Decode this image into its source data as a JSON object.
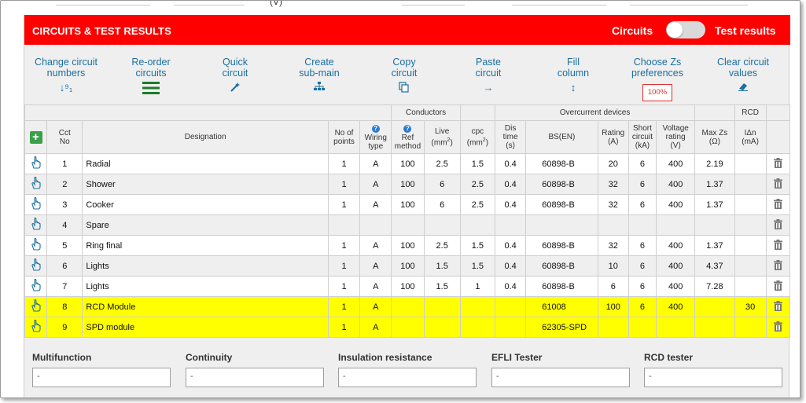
{
  "top_strip": {
    "unit_label": "(V)"
  },
  "header": {
    "title": "CIRCUITS & TEST RESULTS",
    "toggle_left_label": "Circuits",
    "toggle_right_label": "Test results",
    "colors": {
      "accent": "#ff0000",
      "link": "#1a6fa0",
      "highlight": "#ffff00"
    }
  },
  "toolbar": [
    {
      "label": "Change circuit numbers",
      "icon": "sort-numeric-icon",
      "glyph": "↓⁹₁"
    },
    {
      "label": "Re-order circuits",
      "icon": "hamburger-icon",
      "glyph": ""
    },
    {
      "label": "Quick circuit",
      "icon": "magic-wand-icon",
      "glyph": ""
    },
    {
      "label": "Create sub-main",
      "icon": "sitemap-icon",
      "glyph": ""
    },
    {
      "label": "Copy circuit",
      "icon": "copy-icon",
      "glyph": ""
    },
    {
      "label": "Paste circuit",
      "icon": "arrow-right-icon",
      "glyph": "→"
    },
    {
      "label": "Fill column",
      "icon": "arrows-vertical-icon",
      "glyph": "↕"
    },
    {
      "label": "Choose Zs preferences",
      "icon": "badge",
      "badge": "100%"
    },
    {
      "label": "Clear circuit values",
      "icon": "eraser-icon",
      "glyph": ""
    }
  ],
  "table": {
    "group_headers": {
      "conductors": "Conductors",
      "overcurrent": "Overcurrent devices",
      "rcd": "RCD"
    },
    "columns": {
      "cct_no": [
        "Cct",
        "No"
      ],
      "designation": "Designation",
      "no_of_points": [
        "No of",
        "points"
      ],
      "wiring_type": [
        "Wiring",
        "type"
      ],
      "ref_method": [
        "Ref",
        "method"
      ],
      "live": [
        "Live",
        "(mm",
        ")"
      ],
      "cpc": [
        "cpc",
        "(mm",
        ")"
      ],
      "dis_time": [
        "Dis",
        "time",
        "(s)"
      ],
      "bs_en": "BS(EN)",
      "rating": [
        "Rating",
        "(A)"
      ],
      "short_circuit": [
        "Short",
        "circuit",
        "(kA)"
      ],
      "voltage_rating": [
        "Voltage",
        "rating",
        "(V)"
      ],
      "max_zs": [
        "Max Zs",
        "(Ω)"
      ],
      "idn": [
        "IΔn",
        "(mA)"
      ]
    },
    "rows": [
      {
        "no": "1",
        "designation": "Radial",
        "points": "1",
        "wiring": "A",
        "ref": "100",
        "live": "2.5",
        "cpc": "1.5",
        "dis": "0.4",
        "bsen": "60898-B",
        "rating": "20",
        "sc": "6",
        "volt": "400",
        "zs": "2.19",
        "idn": "",
        "highlight": false
      },
      {
        "no": "2",
        "designation": "Shower",
        "points": "1",
        "wiring": "A",
        "ref": "100",
        "live": "6",
        "cpc": "2.5",
        "dis": "0.4",
        "bsen": "60898-B",
        "rating": "32",
        "sc": "6",
        "volt": "400",
        "zs": "1.37",
        "idn": "",
        "highlight": false
      },
      {
        "no": "3",
        "designation": "Cooker",
        "points": "1",
        "wiring": "A",
        "ref": "100",
        "live": "6",
        "cpc": "2.5",
        "dis": "0.4",
        "bsen": "60898-B",
        "rating": "32",
        "sc": "6",
        "volt": "400",
        "zs": "1.37",
        "idn": "",
        "highlight": false
      },
      {
        "no": "4",
        "designation": "Spare",
        "points": "",
        "wiring": "",
        "ref": "",
        "live": "",
        "cpc": "",
        "dis": "",
        "bsen": "",
        "rating": "",
        "sc": "",
        "volt": "",
        "zs": "",
        "idn": "",
        "highlight": false
      },
      {
        "no": "5",
        "designation": "Ring final",
        "points": "1",
        "wiring": "A",
        "ref": "100",
        "live": "2.5",
        "cpc": "1.5",
        "dis": "0.4",
        "bsen": "60898-B",
        "rating": "32",
        "sc": "6",
        "volt": "400",
        "zs": "1.37",
        "idn": "",
        "highlight": false
      },
      {
        "no": "6",
        "designation": "Lights",
        "points": "1",
        "wiring": "A",
        "ref": "100",
        "live": "1.5",
        "cpc": "1.5",
        "dis": "0.4",
        "bsen": "60898-B",
        "rating": "10",
        "sc": "6",
        "volt": "400",
        "zs": "4.37",
        "idn": "",
        "highlight": false
      },
      {
        "no": "7",
        "designation": "Lights",
        "points": "1",
        "wiring": "A",
        "ref": "100",
        "live": "1.5",
        "cpc": "1",
        "dis": "0.4",
        "bsen": "60898-B",
        "rating": "6",
        "sc": "6",
        "volt": "400",
        "zs": "7.28",
        "idn": "",
        "highlight": false
      },
      {
        "no": "8",
        "designation": "RCD Module",
        "points": "1",
        "wiring": "A",
        "ref": "",
        "live": "",
        "cpc": "",
        "dis": "",
        "bsen": "61008",
        "rating": "100",
        "sc": "6",
        "volt": "400",
        "zs": "",
        "idn": "30",
        "highlight": true
      },
      {
        "no": "9",
        "designation": "SPD module",
        "points": "1",
        "wiring": "A",
        "ref": "",
        "live": "",
        "cpc": "",
        "dis": "",
        "bsen": "62305-SPD",
        "rating": "",
        "sc": "",
        "volt": "",
        "zs": "",
        "idn": "",
        "highlight": true
      }
    ]
  },
  "testers": [
    {
      "label": "Multifunction",
      "value": "-"
    },
    {
      "label": "Continuity",
      "value": "-"
    },
    {
      "label": "Insulation resistance",
      "value": "-"
    },
    {
      "label": "EFLI Tester",
      "value": "-"
    },
    {
      "label": "RCD tester",
      "value": "-"
    }
  ]
}
